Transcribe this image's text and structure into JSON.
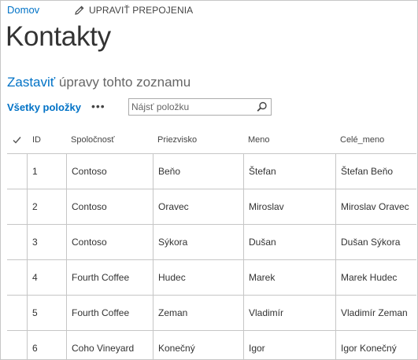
{
  "nav": {
    "home": "Domov",
    "edit_links": "UPRAVIŤ PREPOJENIA"
  },
  "page": {
    "title": "Kontakty"
  },
  "editing": {
    "stop_link": "Zastaviť",
    "rest": " úpravy tohto zoznamu"
  },
  "view": {
    "all_items": "Všetky položky",
    "more": "•••"
  },
  "search": {
    "placeholder": "Nájsť položku"
  },
  "table": {
    "headers": {
      "check": "✓",
      "id": "ID",
      "company": "Spoločnosť",
      "last": "Priezvisko",
      "first": "Meno",
      "full": "Celé_meno"
    },
    "rows": [
      {
        "id": "1",
        "company": "Contoso",
        "last": "Beňo",
        "first": "Štefan",
        "full": "Štefan Beňo"
      },
      {
        "id": "2",
        "company": "Contoso",
        "last": "Oravec",
        "first": "Miroslav",
        "full": "Miroslav Oravec"
      },
      {
        "id": "3",
        "company": "Contoso",
        "last": "Sýkora",
        "first": "Dušan",
        "full": "Dušan Sýkora"
      },
      {
        "id": "4",
        "company": "Fourth Coffee",
        "last": "Hudec",
        "first": "Marek",
        "full": "Marek Hudec"
      },
      {
        "id": "5",
        "company": "Fourth Coffee",
        "last": "Zeman",
        "first": "Vladimír",
        "full": "Vladimír Zeman"
      },
      {
        "id": "6",
        "company": "Coho Vineyard",
        "last": "Konečný",
        "first": "Igor",
        "full": "Igor Konečný"
      }
    ]
  },
  "colors": {
    "link": "#0072c6",
    "border": "#c6c6c6",
    "text": "#333333"
  },
  "icons": {
    "edit": "pencil-icon",
    "search": "magnifier-icon",
    "check": "checkmark-icon"
  }
}
